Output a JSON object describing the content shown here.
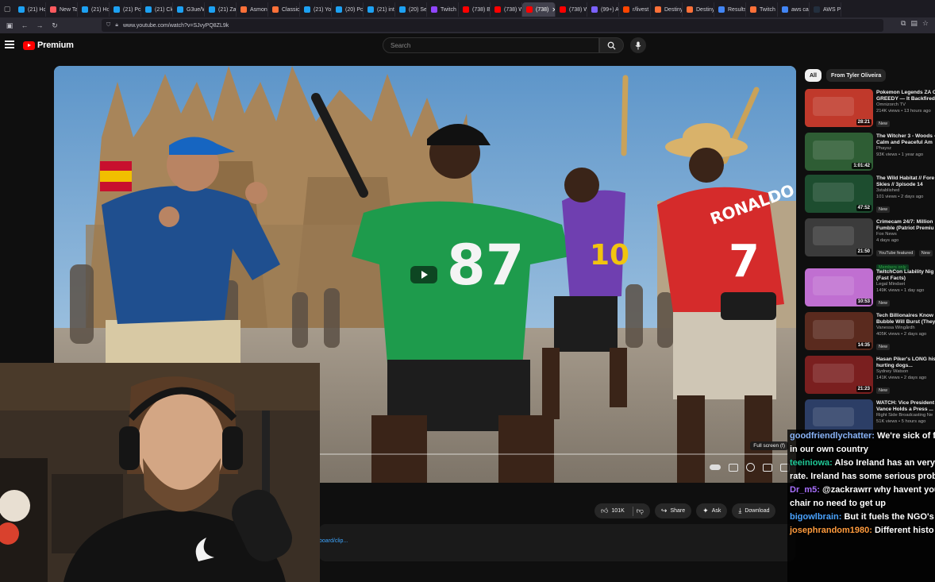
{
  "browser": {
    "tabs": [
      {
        "label": "(21) Ho",
        "color": "#1da1f2",
        "icon": "x-icon"
      },
      {
        "label": "New Tab",
        "color": "#ff5a5f",
        "icon": "firefox-icon"
      },
      {
        "label": "(21) Ho",
        "color": "#1da1f2",
        "icon": "x-icon"
      },
      {
        "label": "(21) Po",
        "color": "#1da1f2",
        "icon": "x-icon"
      },
      {
        "label": "(21) Cle",
        "color": "#1da1f2",
        "icon": "x-icon"
      },
      {
        "label": "G3ue/W",
        "color": "#1da1f2",
        "icon": "x-icon"
      },
      {
        "label": "(21) Zac",
        "color": "#1da1f2",
        "icon": "x-icon"
      },
      {
        "label": "Asmong",
        "color": "#ff7139",
        "icon": "firefox-icon"
      },
      {
        "label": "Classic",
        "color": "#ff7139",
        "icon": "firefox-icon"
      },
      {
        "label": "(21) Yo",
        "color": "#1da1f2",
        "icon": "x-icon"
      },
      {
        "label": "(20) Po",
        "color": "#1da1f2",
        "icon": "x-icon"
      },
      {
        "label": "(21) inti",
        "color": "#1da1f2",
        "icon": "x-icon"
      },
      {
        "label": "(20) Sep",
        "color": "#1da1f2",
        "icon": "x-icon"
      },
      {
        "label": "Twitch",
        "color": "#9146ff",
        "icon": "twitch-icon"
      },
      {
        "label": "(738) Bi",
        "color": "#ff0000",
        "icon": "youtube-icon"
      },
      {
        "label": "(738) W",
        "color": "#ff0000",
        "icon": "youtube-icon"
      },
      {
        "label": "(738)",
        "color": "#ff0000",
        "icon": "youtube-icon",
        "active": true
      },
      {
        "label": "(738) W",
        "color": "#ff0000",
        "icon": "youtube-icon"
      },
      {
        "label": "(99+) A",
        "color": "#7b61ff",
        "icon": "app-icon"
      },
      {
        "label": "r/livest",
        "color": "#ff4500",
        "icon": "reddit-icon"
      },
      {
        "label": "Destiny",
        "color": "#ff7139",
        "icon": "firefox-icon"
      },
      {
        "label": "Destiny",
        "color": "#ff7139",
        "icon": "firefox-icon"
      },
      {
        "label": "Results",
        "color": "#4285f4",
        "icon": "search-icon"
      },
      {
        "label": "Twitch C",
        "color": "#ff7139",
        "icon": "firefox-icon"
      },
      {
        "label": "aws can",
        "color": "#4285f4",
        "icon": "google-icon"
      },
      {
        "label": "AWS Pr",
        "color": "#232f3e",
        "icon": "aws-icon"
      }
    ],
    "url": "www.youtube.com/watch?v=SJvyPQ8ZL9k"
  },
  "youtube": {
    "logo_text": "Premium",
    "search_placeholder": "Search"
  },
  "player": {
    "fullscreen_tooltip": "Full screen (f)"
  },
  "actions": {
    "like_count": "101K",
    "share_label": "Share",
    "ask_label": "Ask",
    "download_label": "Download"
  },
  "description": {
    "link_text": "board/clip..."
  },
  "sidebar": {
    "chips": [
      "All",
      "From Tyler Oliveira"
    ],
    "recs": [
      {
        "title": "Pokemon Legends ZA C GREEDY — It Backfired",
        "channel": "Omnizorch TV",
        "stats": "214K views • 13 hours ago",
        "badge": "New",
        "duration": "28:21",
        "color": "#c0392b"
      },
      {
        "title": "The Witcher 3 - Woods - Calm and Peaceful Am",
        "channel": "Phaysz",
        "stats": "93K views • 1 year ago",
        "badge": "",
        "duration": "1:01:42",
        "color": "#2e5d34"
      },
      {
        "title": "The Wild Habitat // Fore Skies // 3pisode 14",
        "channel": "3stablished",
        "stats": "101 views • 2 days ago",
        "badge": "New",
        "duration": "47:52",
        "color": "#1d4d2f"
      },
      {
        "title": "Crimecam 24/7: Million Fumble (Patriot Premiu",
        "channel": "Fox News",
        "stats": "4 days ago",
        "badge2": "YouTube featured",
        "badge": "New",
        "extra": "Members only",
        "duration": "21:50",
        "color": "#3b3b3b"
      },
      {
        "title": "TwitchCon Liability Nig (Fast Facts)",
        "channel": "Legal Mindset",
        "stats": "149K views • 1 day ago",
        "badge": "New",
        "duration": "10:53",
        "color": "#c06fd1"
      },
      {
        "title": "Tech Billionaires Know Bubble Will Burst (They",
        "channel": "Vanessa Wingårdh",
        "stats": "405K views • 2 days ago",
        "badge": "New",
        "duration": "14:35",
        "color": "#5a2a1e"
      },
      {
        "title": "Hasan Piker's LONG his hurting dogs...",
        "channel": "Sydney Watson",
        "stats": "141K views • 2 days ago",
        "badge": "New",
        "duration": "21:23",
        "color": "#7a1f1f"
      },
      {
        "title": "WATCH: Vice President Vance Holds a Press ...",
        "channel": "Right Side Broadcasting Ne",
        "stats": "51K views • 5 hours ago",
        "badge": "",
        "duration": "",
        "color": "#2c3e66"
      }
    ]
  },
  "chat": {
    "messages": [
      {
        "user": "goodfriendlychatter:",
        "text": " We're sick of fo",
        "color": "#8ab4f8"
      },
      {
        "user": "",
        "text": "in our own country",
        "color": "#ffffff"
      },
      {
        "user": "teeiniowa:",
        "text": " Also Ireland has an very l",
        "color": "#20c997"
      },
      {
        "user": "",
        "text": "rate. Ireland has some serious probl",
        "color": "#ffffff"
      },
      {
        "user": "Dr_m5:",
        "text": " @zackrawrr why havent you",
        "color": "#a970ff"
      },
      {
        "user": "",
        "text": "chair no need to get up",
        "color": "#ffffff"
      },
      {
        "user": "bigowlbrain:",
        "text": " But it fuels the NGO's",
        "color": "#4aa3ff"
      },
      {
        "user": "josephrandom1980:",
        "text": " Different histo",
        "color": "#ff9b3d"
      }
    ]
  }
}
